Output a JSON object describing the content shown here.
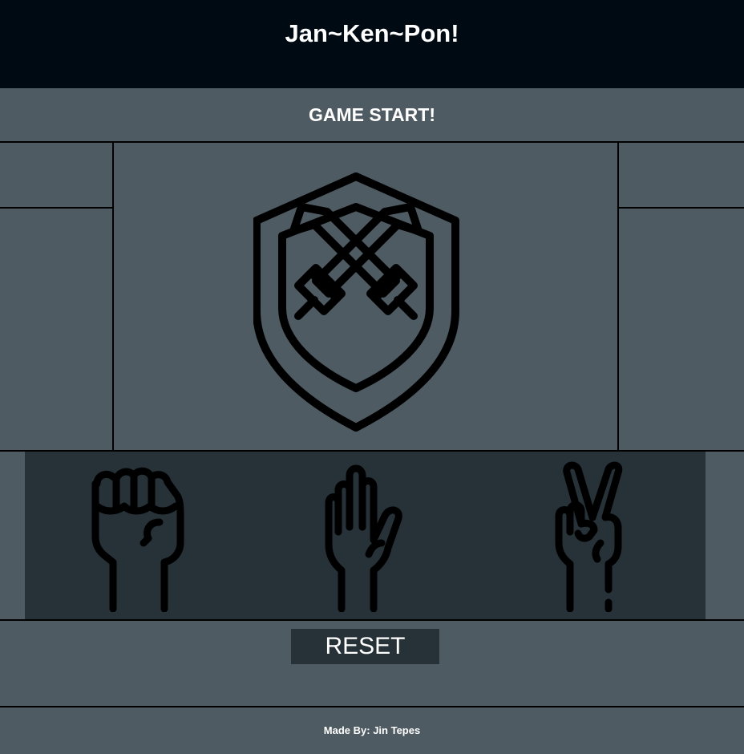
{
  "header": {
    "title": "Jan~Ken~Pon!"
  },
  "status": {
    "text": "GAME START!"
  },
  "arena": {
    "icon": "shield-swords-icon"
  },
  "choices": [
    {
      "name": "rock",
      "icon": "fist-icon"
    },
    {
      "name": "paper",
      "icon": "open-hand-icon"
    },
    {
      "name": "scissors",
      "icon": "peace-sign-icon"
    }
  ],
  "controls": {
    "reset_label": "RESET"
  },
  "footer": {
    "credit": "Made By: Jin Tepes"
  },
  "colors": {
    "header_bg": "#000a12",
    "page_bg": "#4f5b62",
    "panel_bg": "#263238",
    "text": "#ffffff",
    "line": "#000000"
  }
}
